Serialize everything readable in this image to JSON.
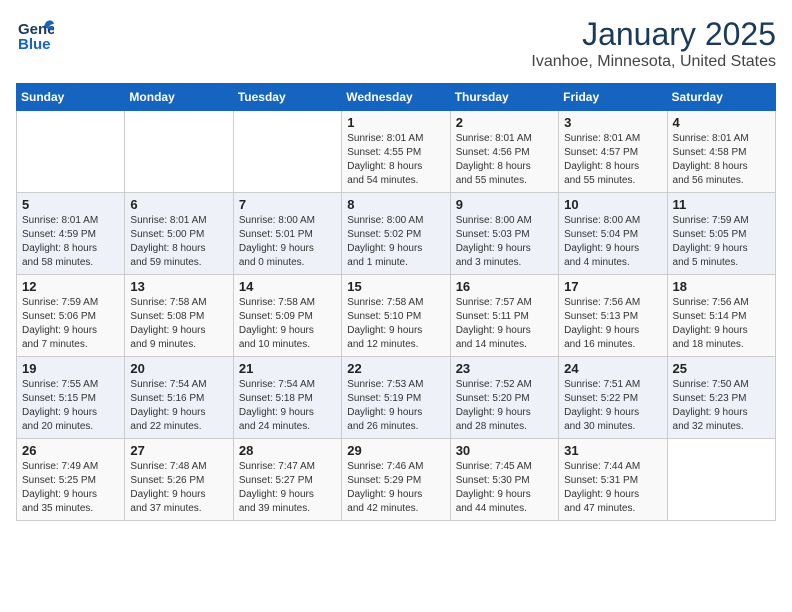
{
  "header": {
    "logo_general": "General",
    "logo_blue": "Blue",
    "title": "January 2025",
    "subtitle": "Ivanhoe, Minnesota, United States"
  },
  "days_of_week": [
    "Sunday",
    "Monday",
    "Tuesday",
    "Wednesday",
    "Thursday",
    "Friday",
    "Saturday"
  ],
  "weeks": [
    [
      {
        "day": "",
        "info": ""
      },
      {
        "day": "",
        "info": ""
      },
      {
        "day": "",
        "info": ""
      },
      {
        "day": "1",
        "info": "Sunrise: 8:01 AM\nSunset: 4:55 PM\nDaylight: 8 hours\nand 54 minutes."
      },
      {
        "day": "2",
        "info": "Sunrise: 8:01 AM\nSunset: 4:56 PM\nDaylight: 8 hours\nand 55 minutes."
      },
      {
        "day": "3",
        "info": "Sunrise: 8:01 AM\nSunset: 4:57 PM\nDaylight: 8 hours\nand 55 minutes."
      },
      {
        "day": "4",
        "info": "Sunrise: 8:01 AM\nSunset: 4:58 PM\nDaylight: 8 hours\nand 56 minutes."
      }
    ],
    [
      {
        "day": "5",
        "info": "Sunrise: 8:01 AM\nSunset: 4:59 PM\nDaylight: 8 hours\nand 58 minutes."
      },
      {
        "day": "6",
        "info": "Sunrise: 8:01 AM\nSunset: 5:00 PM\nDaylight: 8 hours\nand 59 minutes."
      },
      {
        "day": "7",
        "info": "Sunrise: 8:00 AM\nSunset: 5:01 PM\nDaylight: 9 hours\nand 0 minutes."
      },
      {
        "day": "8",
        "info": "Sunrise: 8:00 AM\nSunset: 5:02 PM\nDaylight: 9 hours\nand 1 minute."
      },
      {
        "day": "9",
        "info": "Sunrise: 8:00 AM\nSunset: 5:03 PM\nDaylight: 9 hours\nand 3 minutes."
      },
      {
        "day": "10",
        "info": "Sunrise: 8:00 AM\nSunset: 5:04 PM\nDaylight: 9 hours\nand 4 minutes."
      },
      {
        "day": "11",
        "info": "Sunrise: 7:59 AM\nSunset: 5:05 PM\nDaylight: 9 hours\nand 5 minutes."
      }
    ],
    [
      {
        "day": "12",
        "info": "Sunrise: 7:59 AM\nSunset: 5:06 PM\nDaylight: 9 hours\nand 7 minutes."
      },
      {
        "day": "13",
        "info": "Sunrise: 7:58 AM\nSunset: 5:08 PM\nDaylight: 9 hours\nand 9 minutes."
      },
      {
        "day": "14",
        "info": "Sunrise: 7:58 AM\nSunset: 5:09 PM\nDaylight: 9 hours\nand 10 minutes."
      },
      {
        "day": "15",
        "info": "Sunrise: 7:58 AM\nSunset: 5:10 PM\nDaylight: 9 hours\nand 12 minutes."
      },
      {
        "day": "16",
        "info": "Sunrise: 7:57 AM\nSunset: 5:11 PM\nDaylight: 9 hours\nand 14 minutes."
      },
      {
        "day": "17",
        "info": "Sunrise: 7:56 AM\nSunset: 5:13 PM\nDaylight: 9 hours\nand 16 minutes."
      },
      {
        "day": "18",
        "info": "Sunrise: 7:56 AM\nSunset: 5:14 PM\nDaylight: 9 hours\nand 18 minutes."
      }
    ],
    [
      {
        "day": "19",
        "info": "Sunrise: 7:55 AM\nSunset: 5:15 PM\nDaylight: 9 hours\nand 20 minutes."
      },
      {
        "day": "20",
        "info": "Sunrise: 7:54 AM\nSunset: 5:16 PM\nDaylight: 9 hours\nand 22 minutes."
      },
      {
        "day": "21",
        "info": "Sunrise: 7:54 AM\nSunset: 5:18 PM\nDaylight: 9 hours\nand 24 minutes."
      },
      {
        "day": "22",
        "info": "Sunrise: 7:53 AM\nSunset: 5:19 PM\nDaylight: 9 hours\nand 26 minutes."
      },
      {
        "day": "23",
        "info": "Sunrise: 7:52 AM\nSunset: 5:20 PM\nDaylight: 9 hours\nand 28 minutes."
      },
      {
        "day": "24",
        "info": "Sunrise: 7:51 AM\nSunset: 5:22 PM\nDaylight: 9 hours\nand 30 minutes."
      },
      {
        "day": "25",
        "info": "Sunrise: 7:50 AM\nSunset: 5:23 PM\nDaylight: 9 hours\nand 32 minutes."
      }
    ],
    [
      {
        "day": "26",
        "info": "Sunrise: 7:49 AM\nSunset: 5:25 PM\nDaylight: 9 hours\nand 35 minutes."
      },
      {
        "day": "27",
        "info": "Sunrise: 7:48 AM\nSunset: 5:26 PM\nDaylight: 9 hours\nand 37 minutes."
      },
      {
        "day": "28",
        "info": "Sunrise: 7:47 AM\nSunset: 5:27 PM\nDaylight: 9 hours\nand 39 minutes."
      },
      {
        "day": "29",
        "info": "Sunrise: 7:46 AM\nSunset: 5:29 PM\nDaylight: 9 hours\nand 42 minutes."
      },
      {
        "day": "30",
        "info": "Sunrise: 7:45 AM\nSunset: 5:30 PM\nDaylight: 9 hours\nand 44 minutes."
      },
      {
        "day": "31",
        "info": "Sunrise: 7:44 AM\nSunset: 5:31 PM\nDaylight: 9 hours\nand 47 minutes."
      },
      {
        "day": "",
        "info": ""
      }
    ]
  ]
}
